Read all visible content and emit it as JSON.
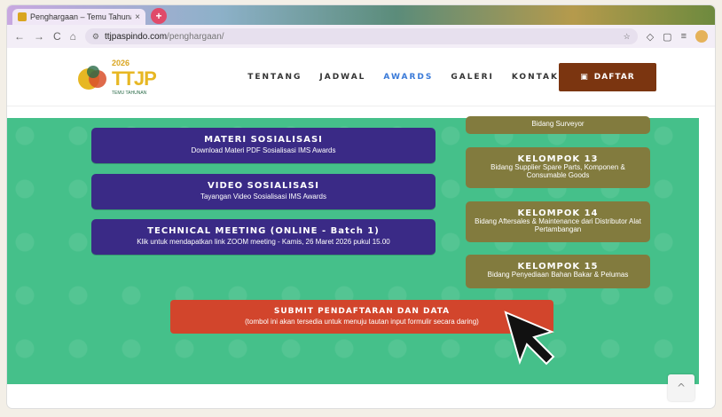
{
  "browser": {
    "tab_title": "Penghargaan – Temu Tahunan",
    "tab_close": "×",
    "new_tab": "+",
    "nav_back": "←",
    "nav_forward": "→",
    "nav_reload": "C",
    "nav_home": "⌂",
    "url_host": "ttjpaspindo.com",
    "url_path": "/penghargaan/",
    "star": "☆"
  },
  "site": {
    "logo_year": "2026",
    "logo_text": "TTJP",
    "logo_sub": "TEMU TAHUNAN",
    "menu": [
      "TENTANG",
      "JADWAL",
      "AWARDS",
      "GALERI",
      "KONTAK"
    ],
    "active_menu": "AWARDS",
    "daftar_icon": "▣",
    "daftar_label": "DAFTAR"
  },
  "left_buttons": [
    {
      "title": "MATERI SOSIALISASI",
      "subtitle": "Download Materi PDF Sosialisasi IMS Awards"
    },
    {
      "title": "VIDEO SOSIALISASI",
      "subtitle": "Tayangan Video Sosialisasi IMS Awards"
    },
    {
      "title": "TECHNICAL MEETING (ONLINE - Batch 1)",
      "subtitle": "Klik untuk mendapatkan link ZOOM meeting - Kamis, 26 Maret 2026 pukul 15.00"
    }
  ],
  "right_buttons": [
    {
      "title": "",
      "subtitle": "Bidang Surveyor"
    },
    {
      "title": "KELOMPOK 13",
      "subtitle": "Bidang Supplier Spare Parts, Komponen & Consumable Goods"
    },
    {
      "title": "KELOMPOK 14",
      "subtitle": "Bidang Aftersales & Maintenance dari Distributor Alat Pertambangan"
    },
    {
      "title": "KELOMPOK 15",
      "subtitle": "Bidang Penyediaan Bahan Bakar & Pelumas"
    }
  ],
  "submit": {
    "title": "SUBMIT PENDAFTARAN DAN DATA",
    "subtitle": "(tombol ini akan tersedia untuk menuju tautan input formulir secara daring)"
  },
  "scroll_top": "^",
  "colors": {
    "green": "#45c08a",
    "purple": "#3a2a86",
    "olive": "#827b3e",
    "red": "#d2452c",
    "brown": "#7b3510"
  }
}
